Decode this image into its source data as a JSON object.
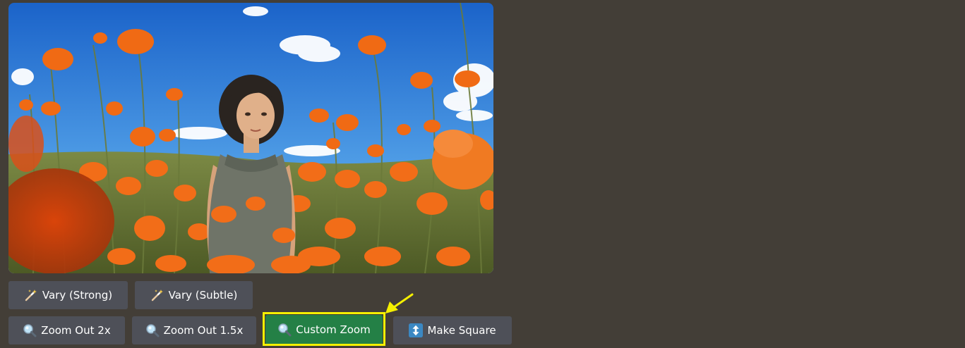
{
  "image": {
    "description_icon": "generated-image-girl-in-poppy-field",
    "colors": {
      "sky_top": "#1e6fd0",
      "sky_bottom": "#5aa6e8",
      "poppy": "#f06a14",
      "field_green": "#6b7a3a"
    }
  },
  "buttons": {
    "vary_strong": {
      "label": "Vary (Strong)",
      "icon": "magic-wand-icon"
    },
    "vary_subtle": {
      "label": "Vary (Subtle)",
      "icon": "magic-wand-icon"
    },
    "zoom_out_2x": {
      "label": "Zoom Out 2x",
      "icon": "magnifier-icon"
    },
    "zoom_out_1_5x": {
      "label": "Zoom Out 1.5x",
      "icon": "magnifier-icon"
    },
    "custom_zoom": {
      "label": "Custom Zoom",
      "icon": "magnifier-icon",
      "highlighted": true
    },
    "make_square": {
      "label": "Make Square",
      "icon": "up-down-arrow-icon"
    }
  },
  "colors": {
    "background": "#433e37",
    "button": "#4e5058",
    "button_active": "#248046",
    "highlight": "#f5f000"
  }
}
